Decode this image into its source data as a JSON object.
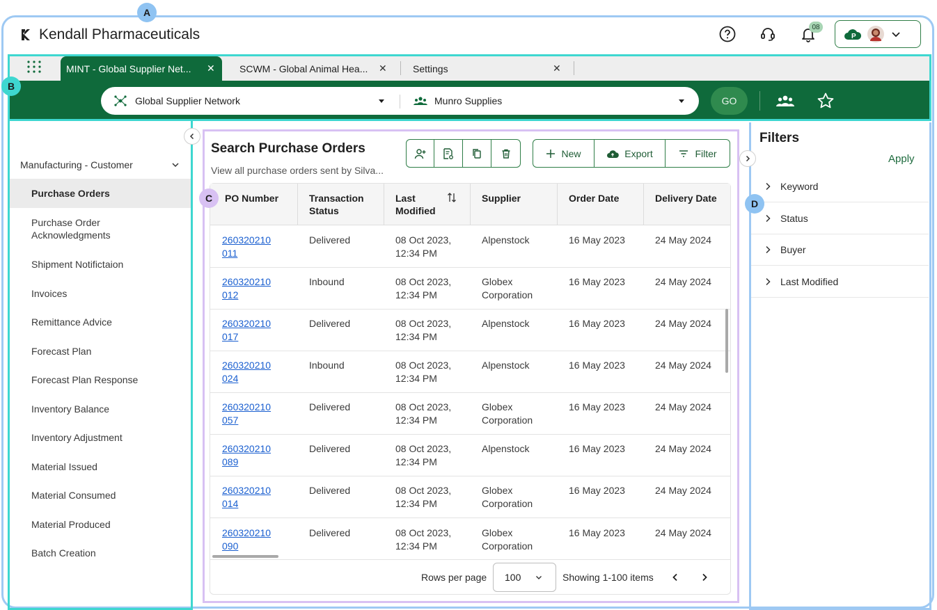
{
  "header": {
    "brand": "Kendall Pharmaceuticals",
    "notification_count": "08",
    "icons": [
      "help-icon",
      "support-headset-icon",
      "bell-icon",
      "org-badge-icon",
      "avatar",
      "chevron-down-icon"
    ]
  },
  "markers": {
    "a": "A",
    "b": "B",
    "c": "C",
    "d": "D"
  },
  "tabs": [
    {
      "label": "MINT - Global Supplier Net...",
      "active": true
    },
    {
      "label": "SCWM - Global Animal Hea...",
      "active": false
    },
    {
      "label": "Settings",
      "active": false
    }
  ],
  "search": {
    "network": "Global Supplier Network",
    "supplier": "Munro Supplies",
    "go_label": "GO"
  },
  "sidebar": {
    "group": "Manufacturing - Customer",
    "items": [
      {
        "label": "Purchase Orders",
        "active": true
      },
      {
        "label": "Purchase Order Acknowledgments"
      },
      {
        "label": "Shipment Notifictaion"
      },
      {
        "label": "Invoices"
      },
      {
        "label": "Remittance Advice"
      },
      {
        "label": "Forecast Plan"
      },
      {
        "label": "Forecast Plan Response"
      },
      {
        "label": "Inventory Balance"
      },
      {
        "label": "Inventory Adjustment"
      },
      {
        "label": "Material Issued"
      },
      {
        "label": "Material Consumed"
      },
      {
        "label": "Material Produced"
      },
      {
        "label": "Batch Creation"
      }
    ]
  },
  "main": {
    "title": "Search Purchase Orders",
    "subtitle": "View all purchase orders sent by Silva...",
    "toolbar": {
      "new_label": "New",
      "export_label": "Export",
      "filter_label": "Filter"
    },
    "columns": [
      "PO Number",
      "Transaction Status",
      "Last Modified",
      "Supplier",
      "Order Date",
      "Delivery Date"
    ],
    "rows": [
      {
        "po": "260320210 011",
        "status": "Delivered",
        "modified": "08 Oct 2023, 12:34 PM",
        "supplier": "Alpenstock",
        "order_date": "16 May 2023",
        "delivery_date": "24 May 2024"
      },
      {
        "po": "260320210 012",
        "status": "Inbound",
        "modified": "08 Oct 2023, 12:34 PM",
        "supplier": "Globex Corporation",
        "order_date": "16 May 2023",
        "delivery_date": "24 May 2024"
      },
      {
        "po": "260320210 017",
        "status": "Delivered",
        "modified": "08 Oct 2023, 12:34 PM",
        "supplier": "Alpenstock",
        "order_date": "16 May 2023",
        "delivery_date": "24 May 2024"
      },
      {
        "po": "260320210 024",
        "status": "Inbound",
        "modified": "08 Oct 2023, 12:34 PM",
        "supplier": "Alpenstock",
        "order_date": "16 May 2023",
        "delivery_date": "24 May 2024"
      },
      {
        "po": "260320210 057",
        "status": "Delivered",
        "modified": "08 Oct 2023, 12:34 PM",
        "supplier": "Globex Corporation",
        "order_date": "16 May 2023",
        "delivery_date": "24 May 2024"
      },
      {
        "po": "260320210 089",
        "status": "Delivered",
        "modified": "08 Oct 2023, 12:34 PM",
        "supplier": "Alpenstock",
        "order_date": "16 May 2023",
        "delivery_date": "24 May 2024"
      },
      {
        "po": "260320210 014",
        "status": "Delivered",
        "modified": "08 Oct 2023, 12:34 PM",
        "supplier": "Globex Corporation",
        "order_date": "16 May 2023",
        "delivery_date": "24 May 2024"
      },
      {
        "po": "260320210 090",
        "status": "Delivered",
        "modified": "08 Oct 2023, 12:34 PM",
        "supplier": "Globex Corporation",
        "order_date": "16 May 2023",
        "delivery_date": "24 May 2024"
      }
    ],
    "footer": {
      "rows_per_page_label": "Rows per page",
      "rows_per_page_value": "100",
      "showing": "Showing 1-100 items"
    }
  },
  "filters": {
    "title": "Filters",
    "apply_label": "Apply",
    "items": [
      "Keyword",
      "Status",
      "Buyer",
      "Last Modified"
    ]
  },
  "colors": {
    "brand_green": "#0f6a3b",
    "link": "#1a5fd0"
  }
}
